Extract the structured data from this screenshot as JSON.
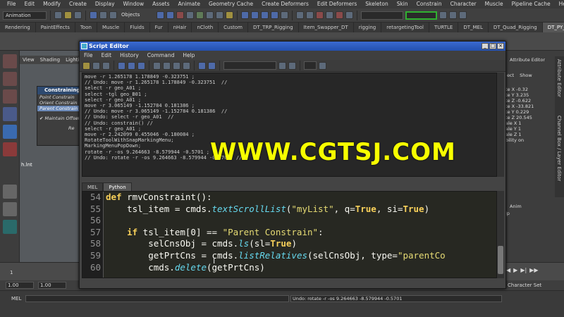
{
  "menubar": {
    "items": [
      "File",
      "Edit",
      "Modify",
      "Create",
      "Display",
      "Window",
      "Assets",
      "Animate",
      "Geometry Cache",
      "Create Deformers",
      "Edit Deformers",
      "Skeleton",
      "Skin",
      "Constrain",
      "Character",
      "Muscle",
      "Pipeline Cache",
      "Help"
    ]
  },
  "status": {
    "mode": "Animation",
    "objects": "Objects"
  },
  "shelf": {
    "tabs": [
      "Rendering",
      "PaintEffects",
      "Toon",
      "Muscle",
      "Fluids",
      "Fur",
      "nHair",
      "nCloth",
      "Custom",
      "DT_TRP_Rigging",
      "Item_Swapper_DT",
      "rigging",
      "retargetingTool",
      "TURTLE",
      "DT_MEL",
      "DT_Quad_Rigging",
      "DT_PY_Shelf"
    ],
    "active_index": 16
  },
  "viewport": {
    "menu": [
      "View",
      "Shading",
      "Lightin"
    ],
    "label": "h.lnt"
  },
  "constrain_panel": {
    "title": "Constraining",
    "items": [
      "Point Constrain",
      "Orient Constrain",
      "Parent Constrain"
    ],
    "selected_index": 2,
    "checkbox_label": "Maintain Offset",
    "button": "Re"
  },
  "attribute_panel": {
    "header": "Attribute Editor",
    "tabs": [
      "ect",
      "Show"
    ],
    "attrs": [
      "te X -0.32",
      "te Y 3.235",
      "te Z -0.622",
      "te X -33.821",
      "te Y 0.229",
      "te Z 20.545",
      "ale X 1",
      "ale Y 1",
      "ale Z 1",
      "bility on"
    ],
    "anim_tab": "Anim",
    "help": "lp",
    "char_set": "Character Set"
  },
  "side_tabs": [
    "Attribute Editor",
    "Channel Box / Layer Editor"
  ],
  "timeline": {
    "start": "1",
    "range_start": "1.00",
    "range_start2": "1.00"
  },
  "cmdline": {
    "label": "MEL",
    "result": "Undo: rotate -r -os 9.264663 -8.579944 -0.5701"
  },
  "script_editor": {
    "title": "Script Editor",
    "menu": [
      "File",
      "Edit",
      "History",
      "Command",
      "Help"
    ],
    "history": [
      "move -r 1.265178 1.178849 -0.323751 ;",
      "// Undo: move -r 1.265178 1.178849 -0.323751  //",
      "select -r geo_A01 ;",
      "select -tgl geo_B01 ;",
      "select -r geo_A01 ;",
      "move -r 3.065149 -1.152784 0.181386 ;",
      "// Undo: move -r 3.065149 -1.152784 0.181386  //",
      "// Undo: select -r geo_A01  //",
      "// Undo: constrain() //",
      "select -r geo_A01 ;",
      "move -r 2.242099 0.455046 -0.180084 ;",
      "RotateToolWithSnapMarkingMenu;",
      "MarkingMenuPopDown;",
      "rotate -r -os 9.264663 -8.579944 -0.5701 ;",
      "// Undo: rotate -r -os 9.264663 -8.579944 -0.5701  //"
    ],
    "tabs": [
      "MEL",
      "Python"
    ],
    "active_tab": 1,
    "line_numbers": [
      "54",
      "55",
      "56",
      "57",
      "58",
      "59",
      "60"
    ],
    "code": {
      "l54_def": "def",
      "l54_name": " rmvConstraint():",
      "l55_a": "    tsl_item = cmds.",
      "l55_fn": "textScrollList",
      "l55_b": "(",
      "l55_str": "\"myList\"",
      "l55_c": ", q=",
      "l55_t1": "True",
      "l55_d": ", si=",
      "l55_t2": "True",
      "l55_e": ")",
      "l57_if": "    if",
      "l57_a": " tsl_item[0] == ",
      "l57_str": "\"Parent Constrain\"",
      "l57_b": ":",
      "l58_a": "        selCnsObj = cmds.",
      "l58_fn": "ls",
      "l58_b": "(sl=",
      "l58_t": "True",
      "l58_c": ")",
      "l59_a": "        getPrtCns = cmds.",
      "l59_fn": "listRelatives",
      "l59_b": "(selCnsObj, type=",
      "l59_str": "\"parentCo",
      "l60_a": "        cmds.",
      "l60_fn": "delete",
      "l60_b": "(getPrtCns)"
    }
  },
  "watermark": "WWW.CGTSJ.COM"
}
